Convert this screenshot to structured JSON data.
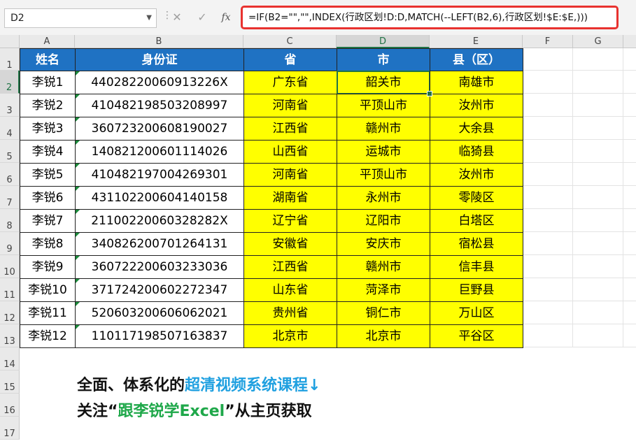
{
  "namebox": {
    "value": "D2"
  },
  "formula": {
    "value": "=IF(B2=\"\",\"\",INDEX(行政区划!D:D,MATCH(--LEFT(B2,6),行政区划!$E:$E,)))",
    "fx": "fx",
    "cancel": "✕",
    "enter": "✓"
  },
  "columns": [
    "A",
    "B",
    "C",
    "D",
    "E",
    "F",
    "G"
  ],
  "rows": [
    "1",
    "2",
    "3",
    "4",
    "5",
    "6",
    "7",
    "8",
    "9",
    "10",
    "11",
    "12",
    "13",
    "14",
    "15",
    "16",
    "17"
  ],
  "headers": [
    "姓名",
    "身份证",
    "省",
    "市",
    "县（区）"
  ],
  "table": [
    [
      "李锐1",
      "44028220060913226X",
      "广东省",
      "韶关市",
      "南雄市"
    ],
    [
      "李锐2",
      "410482198503208997",
      "河南省",
      "平顶山市",
      "汝州市"
    ],
    [
      "李锐3",
      "360723200608190027",
      "江西省",
      "赣州市",
      "大余县"
    ],
    [
      "李锐4",
      "140821200601114026",
      "山西省",
      "运城市",
      "临猗县"
    ],
    [
      "李锐5",
      "410482197004269301",
      "河南省",
      "平顶山市",
      "汝州市"
    ],
    [
      "李锐6",
      "431102200604140158",
      "湖南省",
      "永州市",
      "零陵区"
    ],
    [
      "李锐7",
      "21100220060328282X",
      "辽宁省",
      "辽阳市",
      "白塔区"
    ],
    [
      "李锐8",
      "340826200701264131",
      "安徽省",
      "安庆市",
      "宿松县"
    ],
    [
      "李锐9",
      "360722200603233036",
      "江西省",
      "赣州市",
      "信丰县"
    ],
    [
      "李锐10",
      "371724200602272347",
      "山东省",
      "菏泽市",
      "巨野县"
    ],
    [
      "李锐11",
      "520603200606062021",
      "贵州省",
      "铜仁市",
      "万山区"
    ],
    [
      "李锐12",
      "110117198507163837",
      "北京市",
      "北京市",
      "平谷区"
    ]
  ],
  "promo": {
    "line1_a": "全面、体系化的",
    "line1_b": "超清视频系统课程↓",
    "line2_a": "关注“",
    "line2_b": "跟李锐学Excel",
    "line2_c": "”从主页获取"
  },
  "colors": {
    "header_bg": "#1f72c3",
    "highlight": "#ffff00",
    "selection": "#217346",
    "formula_border": "#e8322f"
  }
}
